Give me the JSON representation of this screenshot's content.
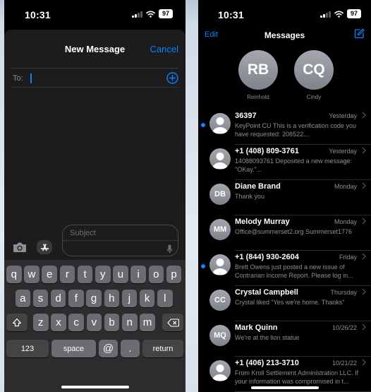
{
  "left_phone": {
    "status": {
      "time": "10:31",
      "battery": "97"
    },
    "title": "New Message",
    "cancel": "Cancel",
    "to_label": "To:",
    "subject_placeholder": "Subject",
    "keyboard": {
      "row1": [
        "q",
        "w",
        "e",
        "r",
        "t",
        "y",
        "u",
        "i",
        "o",
        "p"
      ],
      "row2": [
        "a",
        "s",
        "d",
        "f",
        "g",
        "h",
        "j",
        "k",
        "l"
      ],
      "row3": [
        "z",
        "x",
        "c",
        "v",
        "b",
        "n",
        "m"
      ],
      "numbers": "123",
      "space": "space",
      "at": "@",
      "dot": ".",
      "return": "return"
    }
  },
  "right_phone": {
    "status": {
      "time": "10:31",
      "battery": "97"
    },
    "nav": {
      "edit": "Edit",
      "title": "Messages"
    },
    "pinned": [
      {
        "initials": "RB",
        "name": "Reinhold"
      },
      {
        "initials": "CQ",
        "name": "Cindy"
      }
    ],
    "conversations": [
      {
        "name": "36397",
        "time": "Yesterday",
        "preview": "KeyPoint CU This is a verification code you have requested: 208522...",
        "initials": "",
        "unread": true
      },
      {
        "name": "+1 (408) 809-3761",
        "time": "Yesterday",
        "preview": "14088093761 Deposited a new message: \"OKay.\"...",
        "initials": "",
        "unread": false
      },
      {
        "name": "Diane Brand",
        "time": "Monday",
        "preview": "Thank you",
        "initials": "DB",
        "unread": false
      },
      {
        "name": "Melody Murray",
        "time": "Monday",
        "preview": "Office@summerset2.org Summerset1776",
        "initials": "MM",
        "unread": false
      },
      {
        "name": "+1 (844) 930-2604",
        "time": "Friday",
        "preview": "Brett Owens just posted a new issue of Contrarian Income Report. Please log in...",
        "initials": "",
        "unread": true
      },
      {
        "name": "Crystal Campbell",
        "time": "Thursday",
        "preview": "Crystal liked “Yes we're home. Thanks”",
        "initials": "CC",
        "unread": false
      },
      {
        "name": "Mark Quinn",
        "time": "10/26/22",
        "preview": "We're at the lion statue",
        "initials": "MQ",
        "unread": false
      },
      {
        "name": "+1 (406) 213-3710",
        "time": "10/21/22",
        "preview": "From Kroll Settlement Administration LLC. If your information was compromised in t...",
        "initials": "",
        "unread": false
      }
    ]
  },
  "colors": {
    "accent": "#0a84ff",
    "sheet": "#1c1c1e",
    "keyboard": "#2c2c2e",
    "key": "#6b6b70"
  }
}
